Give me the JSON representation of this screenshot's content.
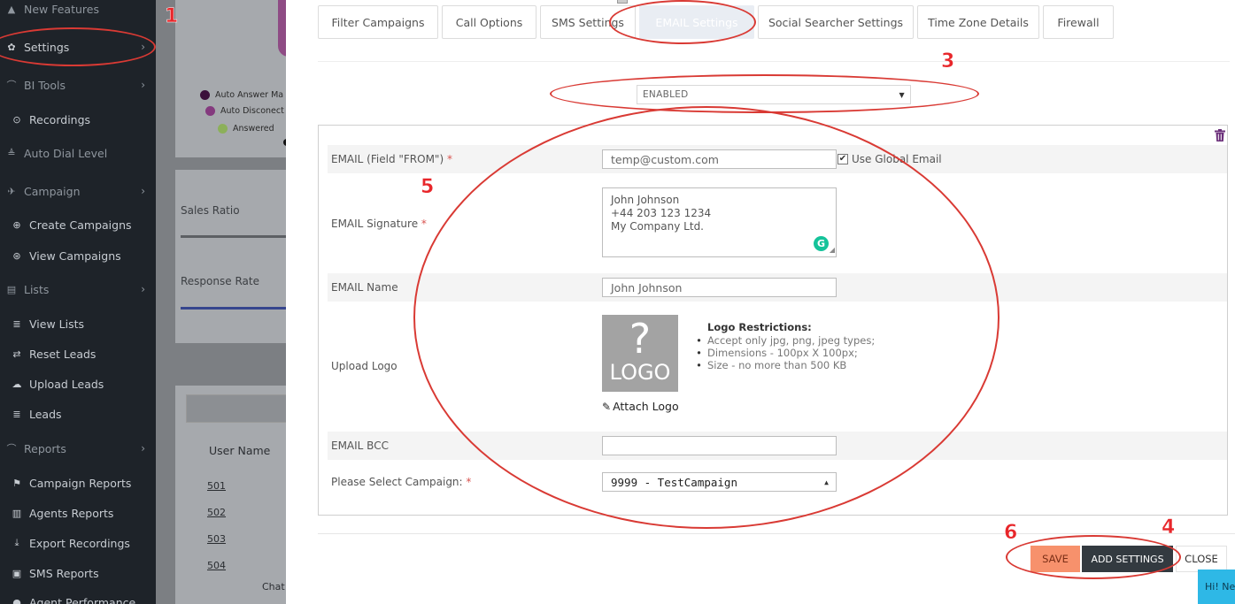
{
  "sidebar": {
    "items": [
      {
        "label": "New Features",
        "icon": "bell-icon",
        "glyph": "▲",
        "chev": false,
        "kind": "top"
      },
      {
        "label": "Settings",
        "icon": "gear-icon",
        "glyph": "✿",
        "chev": true,
        "kind": "top"
      },
      {
        "label": "BI Tools",
        "icon": "chart-line-icon",
        "glyph": "⌒",
        "chev": true,
        "kind": "top"
      },
      {
        "label": "Recordings",
        "icon": "play-circle-icon",
        "glyph": "⊙",
        "chev": false,
        "kind": "sub"
      },
      {
        "label": "Auto Dial Level",
        "icon": "dial-level-icon",
        "glyph": "≜",
        "chev": false,
        "kind": "top"
      },
      {
        "label": "Campaign",
        "icon": "rocket-icon",
        "glyph": "✈",
        "chev": true,
        "kind": "top"
      },
      {
        "label": "Create Campaigns",
        "icon": "plus-circle-icon",
        "glyph": "⊕",
        "chev": false,
        "kind": "sub"
      },
      {
        "label": "View Campaigns",
        "icon": "search-icon",
        "glyph": "⊛",
        "chev": false,
        "kind": "sub"
      },
      {
        "label": "Lists",
        "icon": "list-box-icon",
        "glyph": "▤",
        "chev": true,
        "kind": "top"
      },
      {
        "label": "View Lists",
        "icon": "list-icon",
        "glyph": "≣",
        "chev": false,
        "kind": "sub"
      },
      {
        "label": "Reset Leads",
        "icon": "exchange-icon",
        "glyph": "⇄",
        "chev": false,
        "kind": "sub"
      },
      {
        "label": "Upload Leads",
        "icon": "cloud-upload-icon",
        "glyph": "☁",
        "chev": false,
        "kind": "sub"
      },
      {
        "label": "Leads",
        "icon": "list-icon",
        "glyph": "≣",
        "chev": false,
        "kind": "sub"
      },
      {
        "label": "Reports",
        "icon": "chart-line-icon",
        "glyph": "⌒",
        "chev": true,
        "kind": "top"
      },
      {
        "label": "Campaign Reports",
        "icon": "flag-icon",
        "glyph": "⚑",
        "chev": false,
        "kind": "sub"
      },
      {
        "label": "Agents Reports",
        "icon": "book-icon",
        "glyph": "▥",
        "chev": false,
        "kind": "sub"
      },
      {
        "label": "Export Recordings",
        "icon": "download-icon",
        "glyph": "⤓",
        "chev": false,
        "kind": "sub"
      },
      {
        "label": "SMS Reports",
        "icon": "sms-icon",
        "glyph": "▣",
        "chev": false,
        "kind": "sub"
      },
      {
        "label": "Agent Performance",
        "icon": "user-icon",
        "glyph": "●",
        "chev": false,
        "kind": "sub"
      }
    ]
  },
  "background": {
    "legend": [
      "Auto Answer Ma",
      "Auto Disconect",
      "Answered"
    ],
    "sales_ratio": "Sales Ratio",
    "response_rate": "Response Rate",
    "user_name": "User Name",
    "users": [
      "501",
      "502",
      "503",
      "504"
    ],
    "chat": "Chat"
  },
  "modal": {
    "tabs": [
      "Filter Campaigns",
      "Call Options",
      "SMS Settings",
      "EMAIL Settings",
      "Social Searcher Settings",
      "Time Zone Details",
      "Firewall"
    ],
    "active_tab": "EMAIL Settings",
    "status": "ENABLED",
    "form": {
      "email_from_label": "EMAIL (Field \"FROM\")",
      "email_from_value": "temp@custom.com",
      "use_global_label": "Use Global Email",
      "signature_label": "EMAIL Signature",
      "signature_lines": [
        "John Johnson",
        "+44 203 123 1234",
        "My Company Ltd."
      ],
      "name_label": "EMAIL Name",
      "name_value": "John Johnson",
      "upload_label": "Upload Logo",
      "logo_text": "LOGO",
      "logo_mark": "?",
      "restrictions_title": "Logo Restrictions:",
      "restrictions": [
        "Accept only jpg, png, jpeg types;",
        "Dimensions - 100px X 100px;",
        "Size - no more than 500 KB"
      ],
      "attach_label": "Attach Logo",
      "bcc_label": "EMAIL BCC",
      "bcc_value": "",
      "campaign_label": "Please Select Campaign:",
      "campaign_value": "9999 - TestCampaign",
      "required_mark": "*"
    },
    "buttons": {
      "save": "SAVE",
      "add": "ADD SETTINGS",
      "close": "CLOSE"
    },
    "chat_widget": "Hi! Ne"
  },
  "annotations": [
    "1",
    "3",
    "5",
    "6",
    "4"
  ],
  "colors": {
    "sidebar_bg": "#1e2329",
    "save_bg": "#f7916c",
    "add_bg": "#333a40",
    "annotation": "#e8262a",
    "chat": "#2eb8e6"
  }
}
